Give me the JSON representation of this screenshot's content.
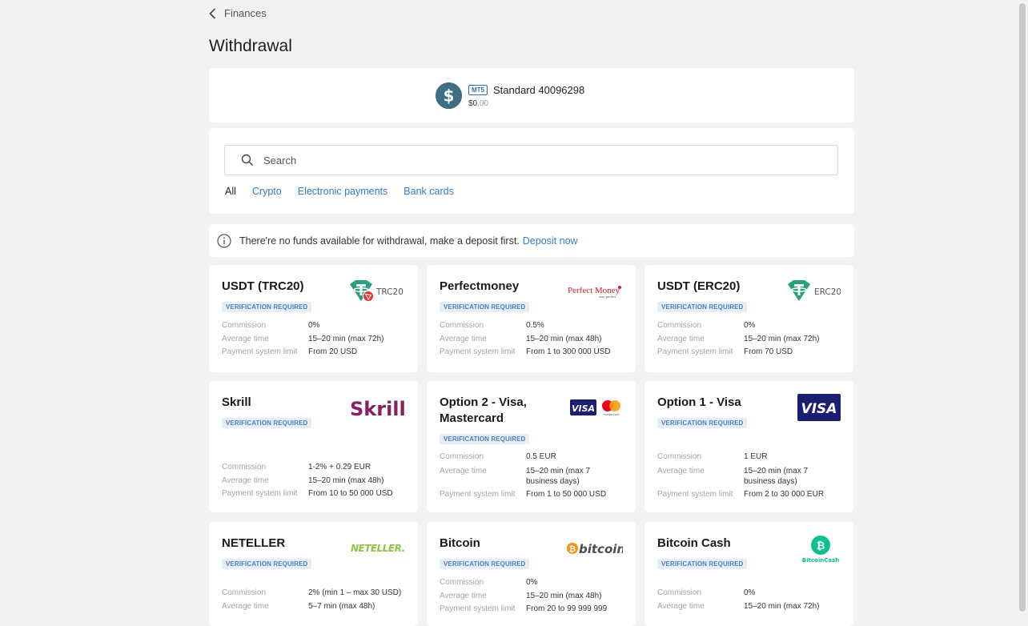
{
  "breadcrumb": {
    "back_label": "Finances"
  },
  "page_title": "Withdrawal",
  "account": {
    "platform_badge": "MT5",
    "name": "Standard 40096298",
    "balance_main": "$0",
    "balance_cents": ",00"
  },
  "search": {
    "placeholder": "Search"
  },
  "tabs": [
    "All",
    "Crypto",
    "Electronic payments",
    "Bank cards"
  ],
  "notice": {
    "message": "There're no funds available for withdrawal, make a deposit first.",
    "link": "Deposit now"
  },
  "labels": {
    "commission": "Commission",
    "average_time": "Average time",
    "limit": "Payment system limit",
    "verification": "VERIFICATION REQUIRED"
  },
  "methods": [
    {
      "name": "USDT (TRC20)",
      "logo": "tether-trc20-logo",
      "logo_text": "TRC20",
      "commission": "0%",
      "time": "15–20 min (max 72h)",
      "limit": "From 20 USD"
    },
    {
      "name": "Perfectmoney",
      "logo": "perfectmoney-logo",
      "logo_text": "Perfect Money",
      "logo_sub": "start perfect",
      "commission": "0.5%",
      "time": "15–20 min (max 48h)",
      "limit": "From 1 to 300 000 USD"
    },
    {
      "name": "USDT (ERC20)",
      "logo": "tether-erc20-logo",
      "logo_text": "ERC20",
      "commission": "0%",
      "time": "15–20 min (max 72h)",
      "limit": "From 70 USD"
    },
    {
      "name": "Skrill",
      "logo": "skrill-logo",
      "logo_text": "Skrill",
      "commission": "1-2% + 0.29 EUR",
      "time": "15–20 min (max 48h)",
      "limit": "From 10 to 50 000 USD"
    },
    {
      "name": "Option 2 - Visa, Mastercard",
      "logo": "visa-mastercard-logo",
      "logo_text": "VISA",
      "commission": "0.5 EUR",
      "time": "15–20 min (max 7 business days)",
      "limit": "From 1 to 50 000 USD"
    },
    {
      "name": "Option 1 - Visa",
      "logo": "visa-logo",
      "logo_text": "VISA",
      "commission": "1 EUR",
      "time": "15–20 min (max 7 business days)",
      "limit": "From 2 to 30 000 EUR"
    },
    {
      "name": "NETELLER",
      "logo": "neteller-logo",
      "logo_text": "NETELLER.",
      "commission": "2% (min 1 – max 30 USD)",
      "time": "5–7 min (max 48h)",
      "limit": ""
    },
    {
      "name": "Bitcoin",
      "logo": "bitcoin-logo",
      "logo_text": "bitcoin",
      "commission": "0%",
      "time": "15–20 min (max 48h)",
      "limit": "From 20 to 99 999 999"
    },
    {
      "name": "Bitcoin Cash",
      "logo": "bitcoin-cash-logo",
      "logo_text": "BitcoinCash",
      "commission": "0%",
      "time": "15–20 min (max 72h)",
      "limit": ""
    }
  ],
  "colors": {
    "link": "#2f7cc9",
    "badge_text": "#4b7fc0",
    "badge_bg": "#e6eef8",
    "tether": "#26a17b",
    "skrill": "#862165",
    "visa": "#1a1f71",
    "neteller": "#8dc63f",
    "bitcoin": "#f7931a",
    "bitcoin_cash": "#0ac18e"
  }
}
